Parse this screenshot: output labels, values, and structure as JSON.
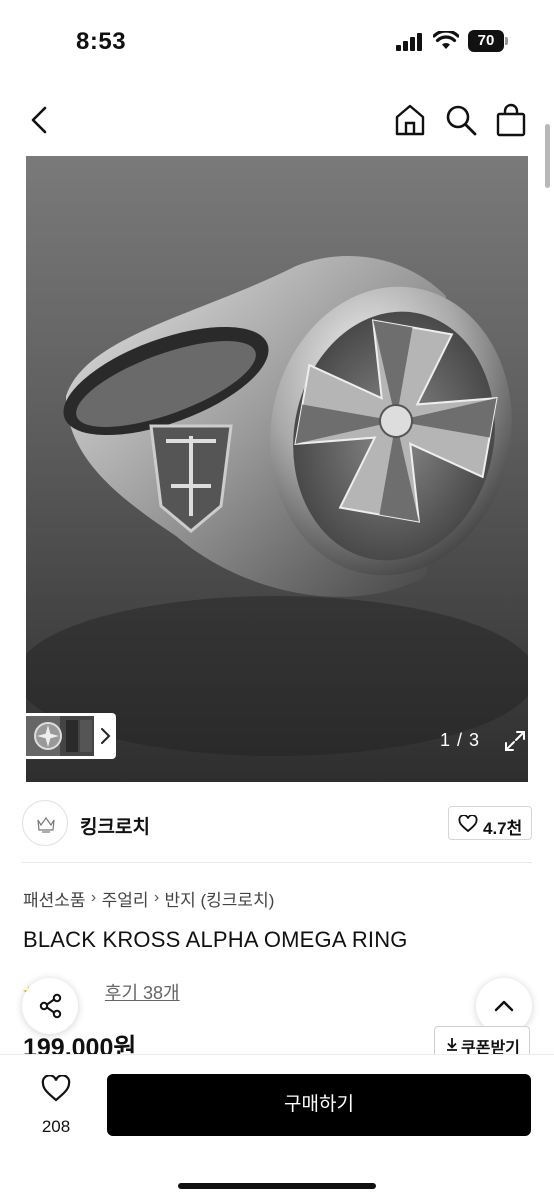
{
  "status_bar": {
    "time": "8:53",
    "battery_level": "70",
    "icons": [
      "signal-icon",
      "wifi-icon",
      "battery-icon"
    ]
  },
  "header": {
    "icons": [
      "back-icon",
      "home-icon",
      "search-icon",
      "bag-icon"
    ]
  },
  "gallery": {
    "page_indicator": "1 / 3",
    "current_page": 1,
    "total_pages": 3,
    "icons": [
      "chevron-right-icon",
      "expand-icon"
    ]
  },
  "store": {
    "name": "킹크로치",
    "like_count": "4.7천",
    "icons": [
      "store-logo",
      "heart-icon"
    ]
  },
  "breadcrumb": {
    "items": [
      "패션소품",
      "주얼리",
      "반지 (킹크로치)"
    ],
    "separator": "›"
  },
  "product": {
    "title": "BLACK KROSS ALPHA OMEGA RING",
    "review_link": "후기 38개",
    "price": "199,000원",
    "coupon_label": "쿠폰받기"
  },
  "bottom_bar": {
    "wish_count": "208",
    "buy_label": "구매하기"
  },
  "colors": {
    "accent": "#000000",
    "star": "#f4b400",
    "text_primary": "#111111",
    "text_secondary": "#444444"
  }
}
